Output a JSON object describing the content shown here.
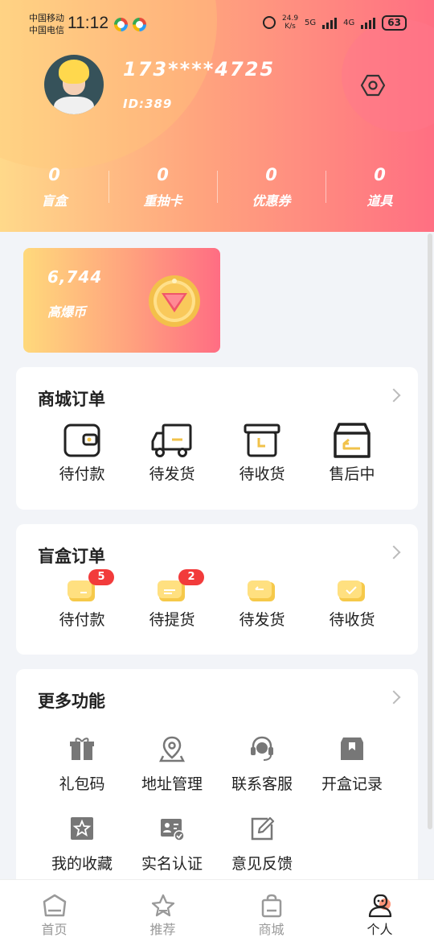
{
  "status_bar": {
    "carrier1": "中国移动",
    "carrier2": "中国电信",
    "time": "11:12",
    "net_speed_value": "24.9",
    "net_speed_unit": "K/s",
    "net1": "5G",
    "net2": "4G",
    "battery": "63"
  },
  "profile": {
    "phone": "173****4725",
    "id": "ID:389"
  },
  "stats": [
    {
      "value": "0",
      "label": "盲盒"
    },
    {
      "value": "0",
      "label": "重抽卡"
    },
    {
      "value": "0",
      "label": "优惠券"
    },
    {
      "value": "0",
      "label": "道具"
    }
  ],
  "coins": {
    "amount": "6,744",
    "label": "高爆币"
  },
  "mall_orders": {
    "title": "商城订单",
    "items": [
      {
        "label": "待付款",
        "icon": "wallet-icon"
      },
      {
        "label": "待发货",
        "icon": "truck-icon"
      },
      {
        "label": "待收货",
        "icon": "box-clock-icon"
      },
      {
        "label": "售后中",
        "icon": "return-box-icon"
      }
    ]
  },
  "blind_orders": {
    "title": "盲盒订单",
    "items": [
      {
        "label": "待付款",
        "badge": "5",
        "icon": "wallet-icon"
      },
      {
        "label": "待提货",
        "badge": "2",
        "icon": "ticket-icon"
      },
      {
        "label": "待发货",
        "badge": "",
        "icon": "return-icon"
      },
      {
        "label": "待收货",
        "badge": "",
        "icon": "check-icon"
      }
    ]
  },
  "more": {
    "title": "更多功能",
    "items": [
      {
        "label": "礼包码",
        "icon": "gift-icon"
      },
      {
        "label": "地址管理",
        "icon": "location-icon"
      },
      {
        "label": "联系客服",
        "icon": "headset-icon"
      },
      {
        "label": "开盒记录",
        "icon": "bookmark-box-icon"
      },
      {
        "label": "我的收藏",
        "icon": "star-icon"
      },
      {
        "label": "实名认证",
        "icon": "id-card-icon"
      },
      {
        "label": "意见反馈",
        "icon": "edit-icon"
      }
    ]
  },
  "tabbar": [
    {
      "label": "首页",
      "icon": "home-icon",
      "active": false
    },
    {
      "label": "推荐",
      "icon": "star-icon",
      "active": false
    },
    {
      "label": "商城",
      "icon": "shopping-bag-icon",
      "active": false
    },
    {
      "label": "个人",
      "icon": "person-icon",
      "active": true
    }
  ],
  "colors": {
    "gradient_start": "#ffd98a",
    "gradient_end": "#ff6f82",
    "badge": "#f23b3b",
    "blind_icon": "#f6c94a"
  }
}
